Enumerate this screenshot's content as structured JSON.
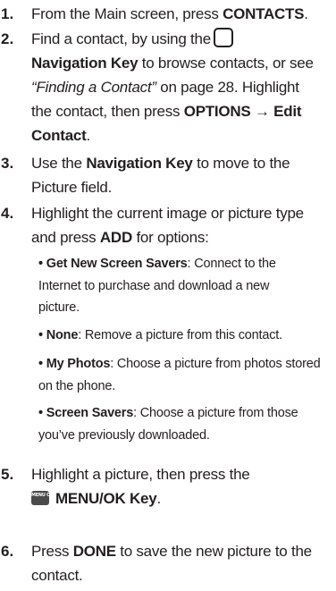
{
  "steps": [
    {
      "number": "1.",
      "text": {
        "a": "From the Main screen, press ",
        "b": "CONTACTS",
        "c": "."
      }
    },
    {
      "number": "2.",
      "text": {
        "a": "Find a contact, by using the",
        "b": "Navigation Key",
        "c": " to browse contacts, or see",
        "d": "“Finding a Contact”",
        "e": " on page 28. Highlight",
        "f": "the contact, then press ",
        "g": "OPTIONS → Edit",
        "h": "Contact",
        "i": "."
      },
      "icon": "navigation-key-icon"
    },
    {
      "number": "3.",
      "text": {
        "a": "Use the ",
        "b": "Navigation Key",
        "c": " to move to the",
        "d": "Picture field."
      }
    },
    {
      "number": "4.",
      "text": {
        "a": "Highlight the current image or picture type",
        "b": "and press ",
        "c": "ADD",
        "d": " for options:"
      },
      "bullets": [
        {
          "bullet": "•",
          "term": "Get New Screen Savers",
          "desc_line1": ": Connect to the",
          "desc_line2": "Internet to purchase and download a new",
          "desc_line3": "picture."
        },
        {
          "bullet": "•",
          "term": "None",
          "desc_line1": ": Remove a picture from this contact."
        },
        {
          "bullet": "•",
          "term": "My Photos",
          "desc_line1": ": Choose a picture from photos stored",
          "desc_line2": "on the phone."
        },
        {
          "bullet": "•",
          "term": "Screen Savers",
          "desc_line1": ": Choose a picture from those",
          "desc_line2": "you’ve previously downloaded."
        }
      ]
    },
    {
      "number": "5.",
      "text": {
        "a": "Highlight a picture, then press the",
        "b": "MENU/OK Key",
        "c": "."
      },
      "icon": "menu-ok-key-icon",
      "icon_label": "MENU OK"
    },
    {
      "number": "6.",
      "text": {
        "a": "Press ",
        "b": "DONE",
        "c": " to save the new picture to the",
        "d": "contact."
      }
    }
  ]
}
